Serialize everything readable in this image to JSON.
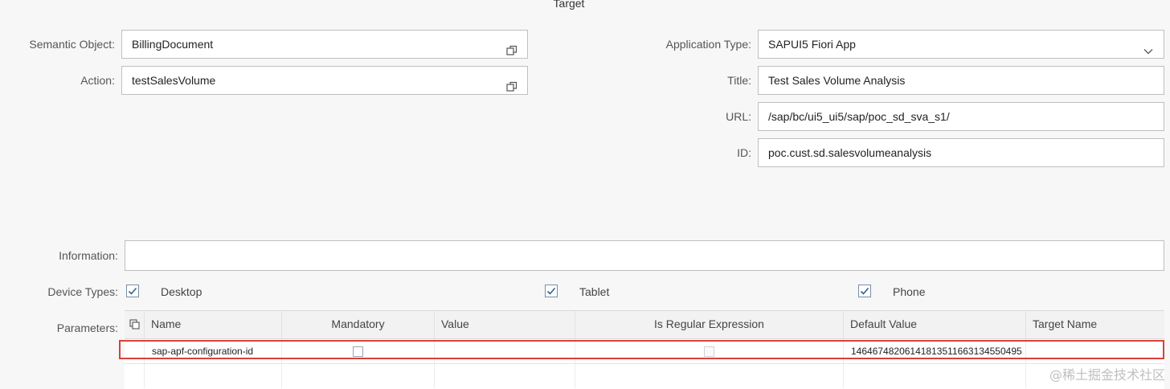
{
  "section": {
    "title": "Target"
  },
  "left_form": {
    "semantic_object": {
      "label": "Semantic Object:",
      "value": "BillingDocument",
      "icon": "value-help-icon"
    },
    "action": {
      "label": "Action:",
      "value": "testSalesVolume",
      "icon": "value-help-icon"
    }
  },
  "right_form": {
    "application_type": {
      "label": "Application Type:",
      "value": "SAPUI5 Fiori App",
      "icon": "chevron-down-icon"
    },
    "title": {
      "label": "Title:",
      "value": "Test Sales Volume Analysis"
    },
    "url": {
      "label": "URL:",
      "value": "/sap/bc/ui5_ui5/sap/poc_sd_sva_s1/"
    },
    "id": {
      "label": "ID:",
      "value": "poc.cust.sd.salesvolumeanalysis"
    }
  },
  "information": {
    "label": "Information:",
    "value": ""
  },
  "device_types": {
    "label": "Device Types:",
    "options": [
      {
        "label": "Desktop",
        "checked": true
      },
      {
        "label": "Tablet",
        "checked": true
      },
      {
        "label": "Phone",
        "checked": true
      }
    ]
  },
  "parameters": {
    "label": "Parameters:",
    "columns": [
      "Name",
      "Mandatory",
      "Value",
      "Is Regular Expression",
      "Default Value",
      "Target Name"
    ],
    "rows": [
      {
        "name": "sap-apf-configuration-id",
        "mandatory": false,
        "value": "",
        "is_regular_expression": false,
        "default_value": "14646748206141813511663134550495",
        "target_name": ""
      }
    ]
  },
  "watermark": "@稀土掘金技术社区",
  "colors": {
    "highlight": "#d9403a",
    "checkbox_border": "#7a8ea7",
    "check_mark": "#346187"
  }
}
